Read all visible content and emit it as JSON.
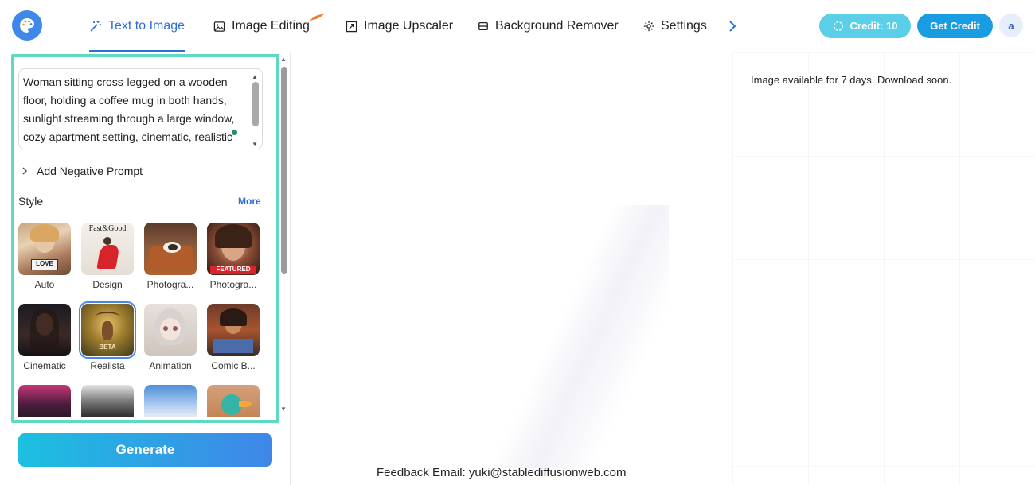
{
  "nav": {
    "tabs": [
      {
        "label": "Text to Image",
        "icon": "magic-wand-icon",
        "active": true
      },
      {
        "label": "Image Editing",
        "icon": "image-icon",
        "hot": true
      },
      {
        "label": "Image Upscaler",
        "icon": "expand-icon"
      },
      {
        "label": "Background Remover",
        "icon": "layers-icon"
      },
      {
        "label": "Settings",
        "icon": "gear-icon"
      }
    ],
    "credit_label": "Credit: 10",
    "get_credit_label": "Get Credit",
    "avatar_initial": "a"
  },
  "prompt": {
    "text": "Woman sitting cross-legged on a wooden floor, holding a coffee mug in both hands, sunlight streaming through a large window, cozy apartment setting, cinematic, realistic"
  },
  "negative_prompt_label": "Add Negative Prompt",
  "style": {
    "label": "Style",
    "more_label": "More",
    "items": [
      {
        "label": "Auto"
      },
      {
        "label": "Design"
      },
      {
        "label": "Photogra..."
      },
      {
        "label": "Photogra..."
      },
      {
        "label": "Cinematic"
      },
      {
        "label": "Realista",
        "selected": true
      },
      {
        "label": "Animation"
      },
      {
        "label": "Comic B..."
      }
    ],
    "thumb_tags": {
      "love": "LOVE",
      "fast_good": "Fast&Good",
      "featured": "FEATURED",
      "beta": "BETA"
    }
  },
  "generate_label": "Generate",
  "canvas": {
    "availability_note": "Image available for 7 days. Download soon.",
    "feedback": "Feedback Email: yuki@stablediffusionweb.com"
  },
  "colors": {
    "accent": "#2f6fd6",
    "highlight": "#5fd9c0",
    "credit_pill": "#5ccfe8",
    "get_credit": "#1a9ce3"
  }
}
